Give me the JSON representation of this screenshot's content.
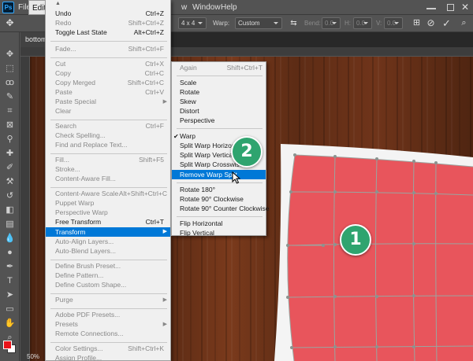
{
  "menubar": {
    "logo": "Ps",
    "items": [
      "File",
      "Edit",
      "w",
      "Window",
      "Help"
    ]
  },
  "options": {
    "grid": "4 x 4",
    "warp_label": "Warp:",
    "warp_value": "Custom",
    "bend_label": "Bend:",
    "bend_value": "0.0",
    "h_label": "H:",
    "h_value": "0.0",
    "v_label": "V:",
    "v_value": "0.0"
  },
  "document": {
    "tab_title": "bottom",
    "zoom": "50%"
  },
  "edit_menu": {
    "items": [
      {
        "label": "Undo",
        "shortcut": "Ctrl+Z"
      },
      {
        "label": "Redo",
        "shortcut": "Shift+Ctrl+Z"
      },
      {
        "label": "Toggle Last State",
        "shortcut": "Alt+Ctrl+Z"
      },
      {
        "label": "Fade...",
        "shortcut": "Shift+Ctrl+F"
      },
      {
        "label": "Cut",
        "shortcut": "Ctrl+X"
      },
      {
        "label": "Copy",
        "shortcut": "Ctrl+C"
      },
      {
        "label": "Copy Merged",
        "shortcut": "Shift+Ctrl+C"
      },
      {
        "label": "Paste",
        "shortcut": "Ctrl+V"
      },
      {
        "label": "Paste Special",
        "shortcut": ""
      },
      {
        "label": "Clear",
        "shortcut": ""
      },
      {
        "label": "Search",
        "shortcut": "Ctrl+F"
      },
      {
        "label": "Check Spelling...",
        "shortcut": ""
      },
      {
        "label": "Find and Replace Text...",
        "shortcut": ""
      },
      {
        "label": "Fill...",
        "shortcut": "Shift+F5"
      },
      {
        "label": "Stroke...",
        "shortcut": ""
      },
      {
        "label": "Content-Aware Fill...",
        "shortcut": ""
      },
      {
        "label": "Content-Aware Scale",
        "shortcut": "Alt+Shift+Ctrl+C"
      },
      {
        "label": "Puppet Warp",
        "shortcut": ""
      },
      {
        "label": "Perspective Warp",
        "shortcut": ""
      },
      {
        "label": "Free Transform",
        "shortcut": "Ctrl+T"
      },
      {
        "label": "Transform",
        "shortcut": ""
      },
      {
        "label": "Auto-Align Layers...",
        "shortcut": ""
      },
      {
        "label": "Auto-Blend Layers...",
        "shortcut": ""
      },
      {
        "label": "Define Brush Preset...",
        "shortcut": ""
      },
      {
        "label": "Define Pattern...",
        "shortcut": ""
      },
      {
        "label": "Define Custom Shape...",
        "shortcut": ""
      },
      {
        "label": "Purge",
        "shortcut": ""
      },
      {
        "label": "Adobe PDF Presets...",
        "shortcut": ""
      },
      {
        "label": "Presets",
        "shortcut": ""
      },
      {
        "label": "Remote Connections...",
        "shortcut": ""
      },
      {
        "label": "Color Settings...",
        "shortcut": "Shift+Ctrl+K"
      },
      {
        "label": "Assign Profile...",
        "shortcut": ""
      }
    ]
  },
  "transform_menu": {
    "items": [
      {
        "label": "Again",
        "shortcut": "Shift+Ctrl+T"
      },
      {
        "label": "Scale",
        "shortcut": ""
      },
      {
        "label": "Rotate",
        "shortcut": ""
      },
      {
        "label": "Skew",
        "shortcut": ""
      },
      {
        "label": "Distort",
        "shortcut": ""
      },
      {
        "label": "Perspective",
        "shortcut": ""
      },
      {
        "label": "Warp",
        "shortcut": ""
      },
      {
        "label": "Split Warp Horizontally",
        "shortcut": ""
      },
      {
        "label": "Split Warp Vertically",
        "shortcut": ""
      },
      {
        "label": "Split Warp Crosswise",
        "shortcut": ""
      },
      {
        "label": "Remove Warp Split",
        "shortcut": ""
      },
      {
        "label": "Rotate 180°",
        "shortcut": ""
      },
      {
        "label": "Rotate 90° Clockwise",
        "shortcut": ""
      },
      {
        "label": "Rotate 90° Counter Clockwise",
        "shortcut": ""
      },
      {
        "label": "Flip Horizontal",
        "shortcut": ""
      },
      {
        "label": "Flip Vertical",
        "shortcut": ""
      }
    ]
  },
  "callouts": [
    "1",
    "2"
  ],
  "colors": {
    "foreground": "#e8131a",
    "background": "#ffffff",
    "highlight": "#0078d7",
    "warp_fill": "#e8555c",
    "badge": "#2fa46f"
  }
}
